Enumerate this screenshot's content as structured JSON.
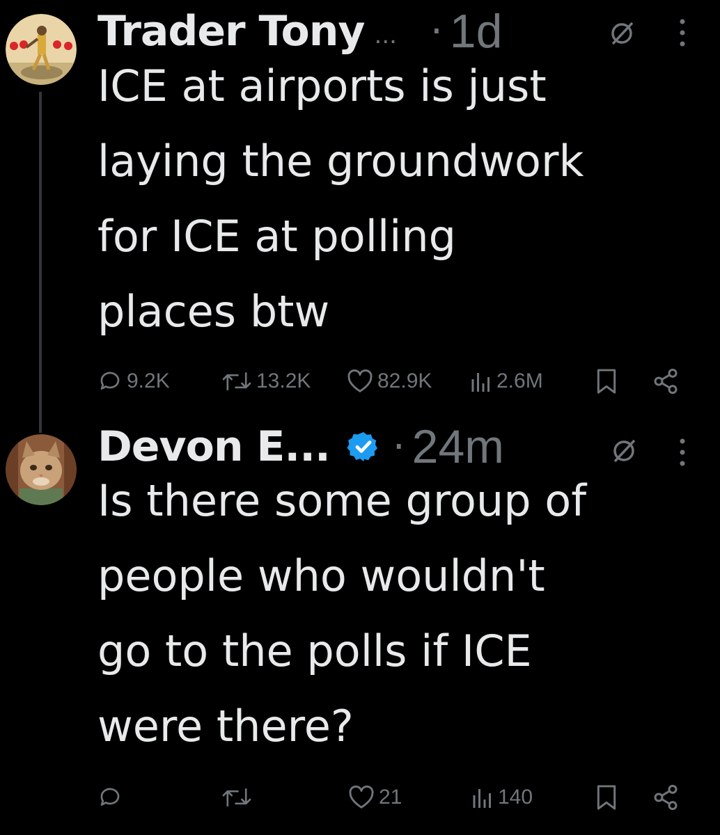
{
  "tweets": [
    {
      "display_name": "Trader Tony",
      "name_ellipsis": "...",
      "separator": "·",
      "time": "1d",
      "verified": false,
      "text_lines": [
        "ICE at airports is just",
        "laying the groundwork",
        "for ICE at polling",
        "places btw"
      ],
      "replies": "9.2K",
      "reposts": "13.2K",
      "likes": "82.9K",
      "views": "2.6M"
    },
    {
      "display_name": "Devon E",
      "name_ellipsis": "...",
      "separator": "·",
      "time": "24m",
      "verified": true,
      "text_lines": [
        "Is there some group of",
        "people who wouldn't",
        "go to the polls if ICE",
        "were there?"
      ],
      "replies": "",
      "reposts": "",
      "likes": "21",
      "views": "140"
    }
  ],
  "icons": {
    "reply": "reply-icon",
    "repost": "repost-icon",
    "like": "heart-icon",
    "views": "views-chart-icon",
    "bookmark": "bookmark-icon",
    "share": "share-icon",
    "grok": "grok-icon",
    "more": "more-dots-icon",
    "verified": "verified-badge-icon"
  },
  "colors": {
    "background": "#000000",
    "text": "#e7e9ea",
    "muted": "#71767b",
    "verified": "#1d9bf0",
    "thread_line": "#333639"
  }
}
